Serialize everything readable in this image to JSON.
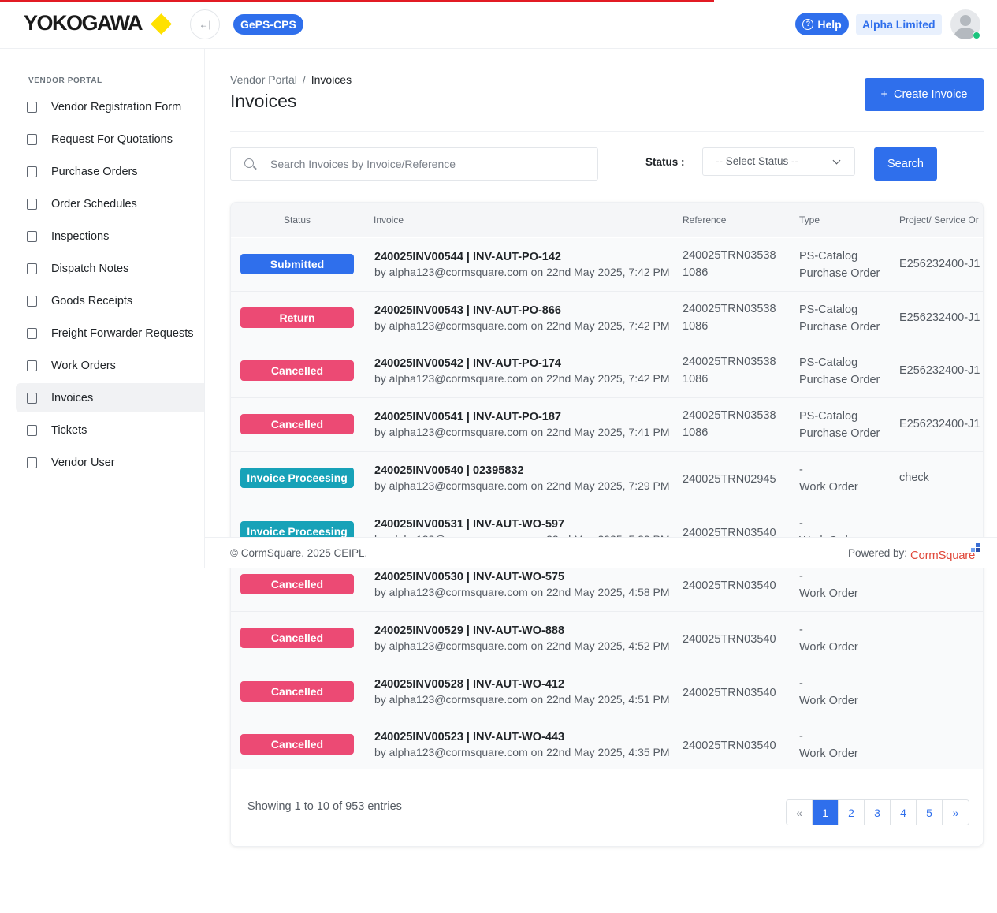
{
  "header": {
    "logo_text": "YOKOGAWA",
    "app_name": "GePS-CPS",
    "help_label": "Help",
    "company": "Alpha Limited",
    "colors": {
      "brand_blue": "#2f6fec",
      "logo_yellow": "#ffe100",
      "progress_red": "#e21b24"
    }
  },
  "sidebar": {
    "heading": "VENDOR PORTAL",
    "items": [
      {
        "label": "Vendor Registration Form",
        "icon": "users-icon"
      },
      {
        "label": "Request For Quotations",
        "icon": "file-icon"
      },
      {
        "label": "Purchase Orders",
        "icon": "chart-file-icon"
      },
      {
        "label": "Order Schedules",
        "icon": "calendar-icon"
      },
      {
        "label": "Inspections",
        "icon": "check-file-icon"
      },
      {
        "label": "Dispatch Notes",
        "icon": "note-icon"
      },
      {
        "label": "Goods Receipts",
        "icon": "receipt-icon"
      },
      {
        "label": "Freight Forwarder Requests",
        "icon": "doc-icon"
      },
      {
        "label": "Work Orders",
        "icon": "doc-icon"
      },
      {
        "label": "Invoices",
        "icon": "invoice-icon",
        "active": true
      },
      {
        "label": "Tickets",
        "icon": "ticket-icon"
      },
      {
        "label": "Vendor User",
        "icon": "doc-icon"
      }
    ]
  },
  "breadcrumb": {
    "parent": "Vendor Portal",
    "separator": "/",
    "current": "Invoices"
  },
  "page": {
    "title": "Invoices",
    "create_label": "Create Invoice",
    "create_symbol": "+"
  },
  "filters": {
    "search_placeholder": "Search Invoices by Invoice/Reference",
    "status_label": "Status :",
    "status_selected": "-- Select Status --",
    "search_button": "Search"
  },
  "table": {
    "columns": [
      "Status",
      "Invoice",
      "Reference",
      "Type",
      "Project/ Service Or"
    ],
    "status_colors": {
      "Submitted": "#2f6fec",
      "Return": "#ec4a74",
      "Cancelled": "#ec4a74",
      "Invoice Proceesing": "#17a2b8"
    },
    "rows": [
      {
        "status": "Submitted",
        "invoice": "240025INV00544 | INV-AUT-PO-142",
        "by": "by alpha123@cormsquare.com on 22nd May 2025, 7:42 PM",
        "ref1": "240025TRN03538",
        "ref2": "1086",
        "type1": "PS-Catalog",
        "type2": "Purchase Order",
        "project": "E256232400-J1"
      },
      {
        "status": "Return",
        "invoice": "240025INV00543 | INV-AUT-PO-866",
        "by": "by alpha123@cormsquare.com on 22nd May 2025, 7:42 PM",
        "ref1": "240025TRN03538",
        "ref2": "1086",
        "type1": "PS-Catalog",
        "type2": "Purchase Order",
        "project": "E256232400-J1"
      },
      {
        "status": "Cancelled",
        "invoice": "240025INV00542 | INV-AUT-PO-174",
        "by": "by alpha123@cormsquare.com on 22nd May 2025, 7:42 PM",
        "ref1": "240025TRN03538",
        "ref2": "1086",
        "type1": "PS-Catalog",
        "type2": "Purchase Order",
        "project": "E256232400-J1"
      },
      {
        "status": "Cancelled",
        "invoice": "240025INV00541 | INV-AUT-PO-187",
        "by": "by alpha123@cormsquare.com on 22nd May 2025, 7:41 PM",
        "ref1": "240025TRN03538",
        "ref2": "1086",
        "type1": "PS-Catalog",
        "type2": "Purchase Order",
        "project": "E256232400-J1"
      },
      {
        "status": "Invoice Proceesing",
        "invoice": "240025INV00540 | 02395832",
        "by": "by alpha123@cormsquare.com on 22nd May 2025, 7:29 PM",
        "ref1": "240025TRN02945",
        "ref2": "",
        "type1": "-",
        "type2": "Work Order",
        "project": "check"
      },
      {
        "status": "Invoice Proceesing",
        "invoice": "240025INV00531 | INV-AUT-WO-597",
        "by": "by alpha123@cormsquare.com on 22nd May 2025, 5:20 PM",
        "ref1": "240025TRN03540",
        "ref2": "",
        "type1": "-",
        "type2": "Work Order",
        "project": ""
      },
      {
        "status": "Cancelled",
        "invoice": "240025INV00530 | INV-AUT-WO-575",
        "by": "by alpha123@cormsquare.com on 22nd May 2025, 4:58 PM",
        "ref1": "240025TRN03540",
        "ref2": "",
        "type1": "-",
        "type2": "Work Order",
        "project": ""
      },
      {
        "status": "Cancelled",
        "invoice": "240025INV00529 | INV-AUT-WO-888",
        "by": "by alpha123@cormsquare.com on 22nd May 2025, 4:52 PM",
        "ref1": "240025TRN03540",
        "ref2": "",
        "type1": "-",
        "type2": "Work Order",
        "project": ""
      },
      {
        "status": "Cancelled",
        "invoice": "240025INV00528 | INV-AUT-WO-412",
        "by": "by alpha123@cormsquare.com on 22nd May 2025, 4:51 PM",
        "ref1": "240025TRN03540",
        "ref2": "",
        "type1": "-",
        "type2": "Work Order",
        "project": ""
      },
      {
        "status": "Cancelled",
        "invoice": "240025INV00523 | INV-AUT-WO-443",
        "by": "by alpha123@cormsquare.com on 22nd May 2025, 4:35 PM",
        "ref1": "240025TRN03540",
        "ref2": "",
        "type1": "-",
        "type2": "Work Order",
        "project": ""
      }
    ]
  },
  "pagination": {
    "summary": "Showing 1 to 10 of 953 entries",
    "prev": "«",
    "pages": [
      "1",
      "2",
      "3",
      "4",
      "5"
    ],
    "current": "1",
    "next": "»"
  },
  "footer": {
    "copyright": "© CormSquare. 2025 CEIPL.",
    "powered_by": "Powered by:",
    "brand": "CormSquare"
  }
}
